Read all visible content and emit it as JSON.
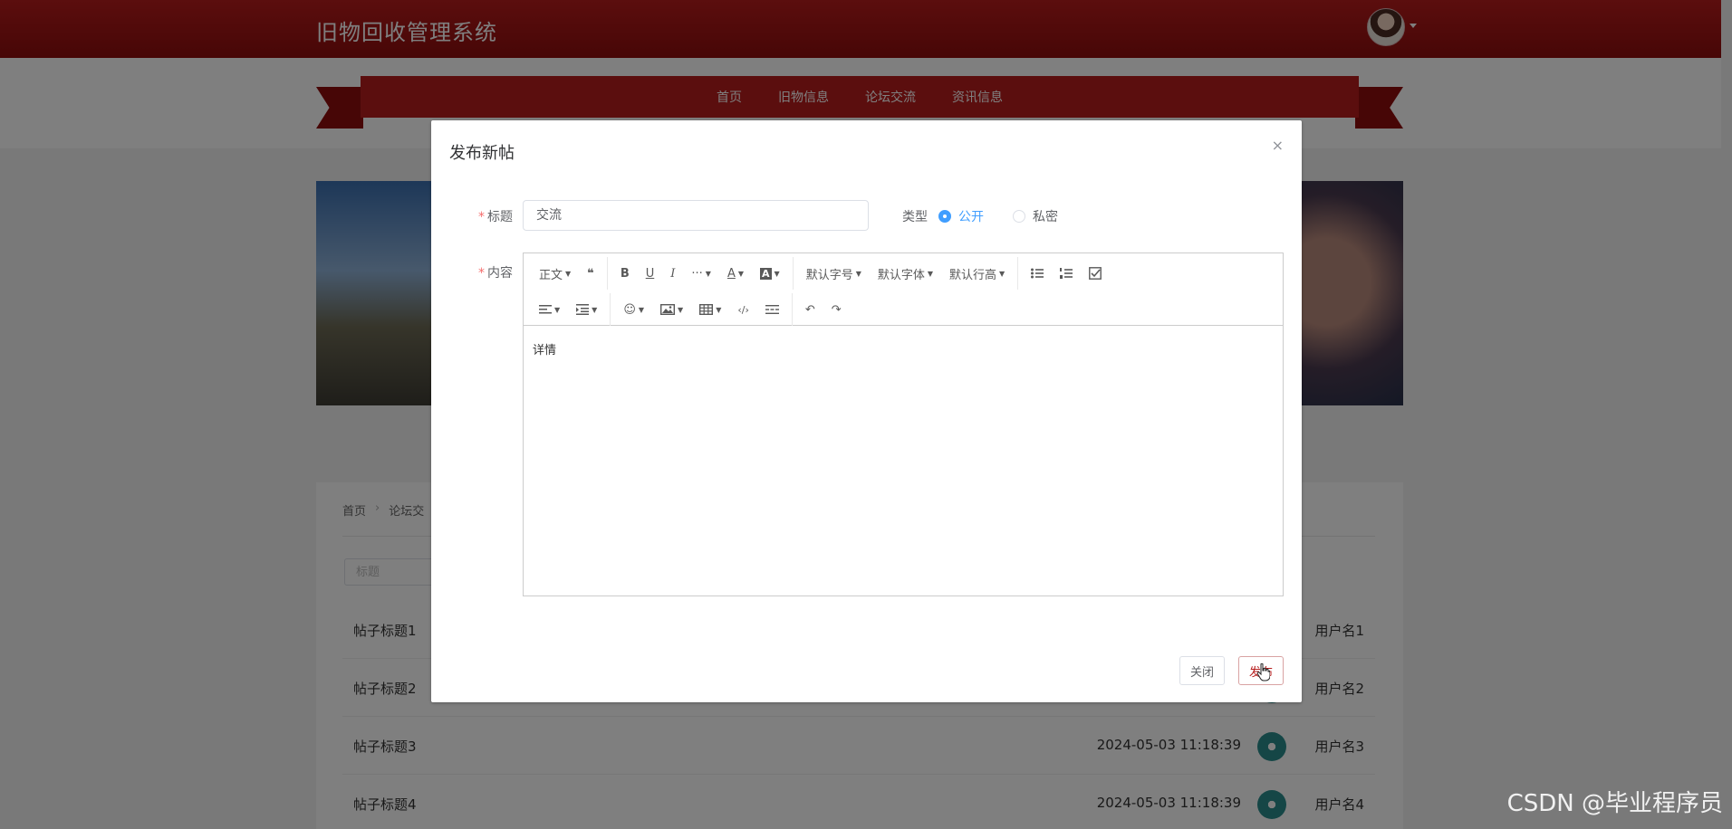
{
  "app": {
    "title": "旧物回收管理系统"
  },
  "nav": {
    "items": [
      "首页",
      "旧物信息",
      "论坛交流",
      "资讯信息"
    ]
  },
  "breadcrumb": {
    "items": [
      "首页",
      "论坛交"
    ]
  },
  "search": {
    "placeholder": "标题"
  },
  "posts": [
    {
      "title": "帖子标题1",
      "time": "",
      "user": "用户名1"
    },
    {
      "title": "帖子标题2",
      "time": "",
      "user": "用户名2"
    },
    {
      "title": "帖子标题3",
      "time": "2024-05-03 11:18:39",
      "user": "用户名3"
    },
    {
      "title": "帖子标题4",
      "time": "2024-05-03 11:18:39",
      "user": "用户名4"
    }
  ],
  "dialog": {
    "title": "发布新帖",
    "close_icon": "×",
    "title_label": "标题",
    "title_value": "交流",
    "type_label": "类型",
    "type_options": [
      "公开",
      "私密"
    ],
    "type_selected": "公开",
    "content_label": "内容",
    "content_text": "详情",
    "toolbar": {
      "paragraph": "正文",
      "font_size": "默认字号",
      "font_family": "默认字体",
      "line_height": "默认行高"
    },
    "close_button": "关闭",
    "publish_button": "发布"
  },
  "watermark": "CSDN @毕业程序员",
  "colors": {
    "primary": "#b71c1c",
    "accent": "#409eff",
    "required": "#f56c6c"
  }
}
